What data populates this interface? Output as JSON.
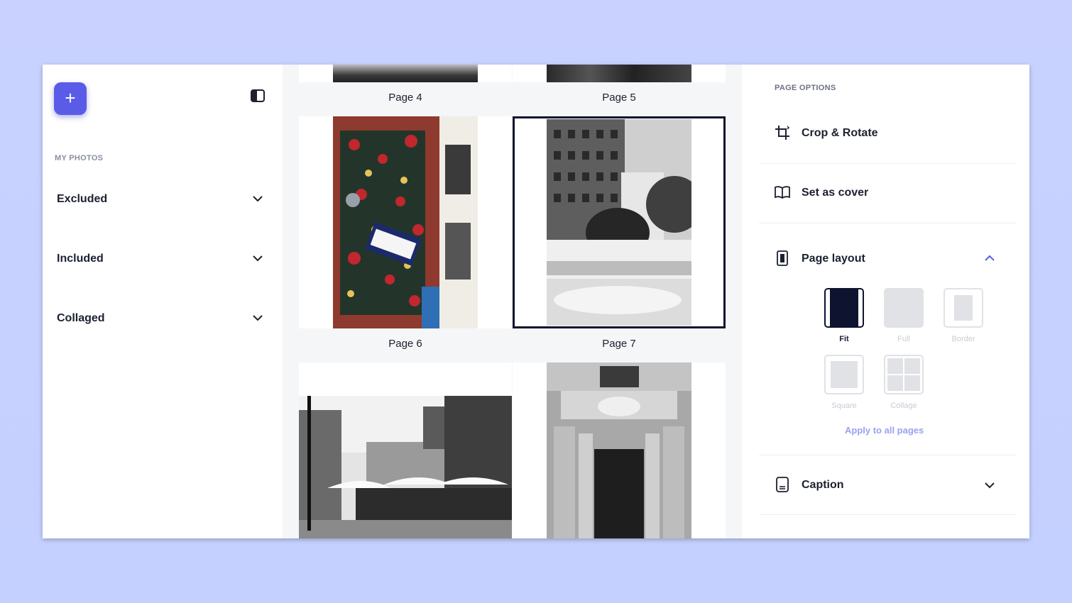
{
  "sidebar": {
    "add_label": "+",
    "section_title": "MY PHOTOS",
    "items": [
      {
        "label": "Excluded"
      },
      {
        "label": "Included"
      },
      {
        "label": "Collaged"
      }
    ]
  },
  "pages": [
    {
      "label": "Page 4"
    },
    {
      "label": "Page 5"
    },
    {
      "label": "Page 6"
    },
    {
      "label": "Page 7"
    }
  ],
  "options": {
    "title": "PAGE OPTIONS",
    "crop_label": "Crop & Rotate",
    "cover_label": "Set as cover",
    "layout_label": "Page layout",
    "caption_label": "Caption",
    "layouts": [
      {
        "label": "Fit"
      },
      {
        "label": "Full"
      },
      {
        "label": "Border"
      },
      {
        "label": "Square"
      },
      {
        "label": "Collage"
      }
    ],
    "apply_label": "Apply to all pages"
  },
  "colors": {
    "accent": "#5a5ce8",
    "selected_border": "#0e1330",
    "background": "#c7d1ff"
  }
}
